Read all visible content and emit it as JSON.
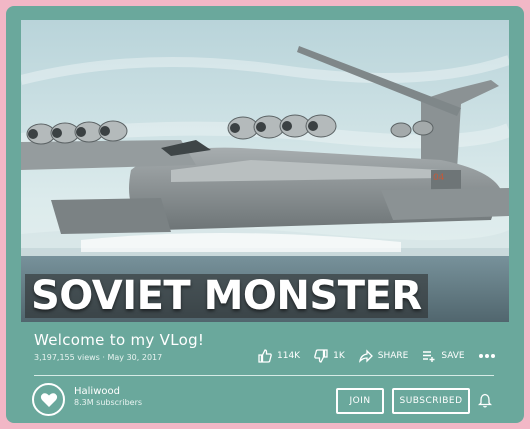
{
  "thumbnail": {
    "caption": "SOVIET MONSTER",
    "description_icon": "ekranoplan-image"
  },
  "video": {
    "title": "Welcome to my VLog!",
    "views": "3,197,155 views",
    "separator": " · ",
    "date": "May 30, 2017"
  },
  "actions": {
    "like_count": "114K",
    "dislike_count": "1K",
    "share_label": "SHARE",
    "save_label": "SAVE"
  },
  "channel": {
    "name": "Haliwood",
    "subscribers": "8.3M subscribers",
    "join_label": "JOIN",
    "subscribed_label": "SUBSCRIBED"
  },
  "colors": {
    "background": "#f2b7c6",
    "card": "#6aa89c",
    "text": "#ffffff"
  }
}
